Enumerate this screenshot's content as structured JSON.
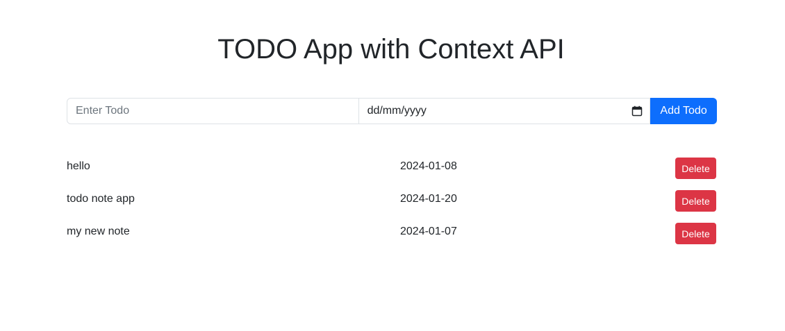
{
  "header": {
    "title": "TODO App with Context API"
  },
  "form": {
    "todo_placeholder": "Enter Todo",
    "todo_value": "",
    "date_placeholder": "dd/mm/yyyy",
    "add_label": "Add Todo",
    "calendar_icon": "calendar-icon"
  },
  "todos": [
    {
      "name": "hello",
      "date": "2024-01-08",
      "delete_label": "Delete"
    },
    {
      "name": "todo note app",
      "date": "2024-01-20",
      "delete_label": "Delete"
    },
    {
      "name": "my new note",
      "date": "2024-01-07",
      "delete_label": "Delete"
    }
  ],
  "colors": {
    "primary": "#0d6efd",
    "danger": "#dc3545",
    "text": "#212529",
    "border": "#dee2e6"
  }
}
